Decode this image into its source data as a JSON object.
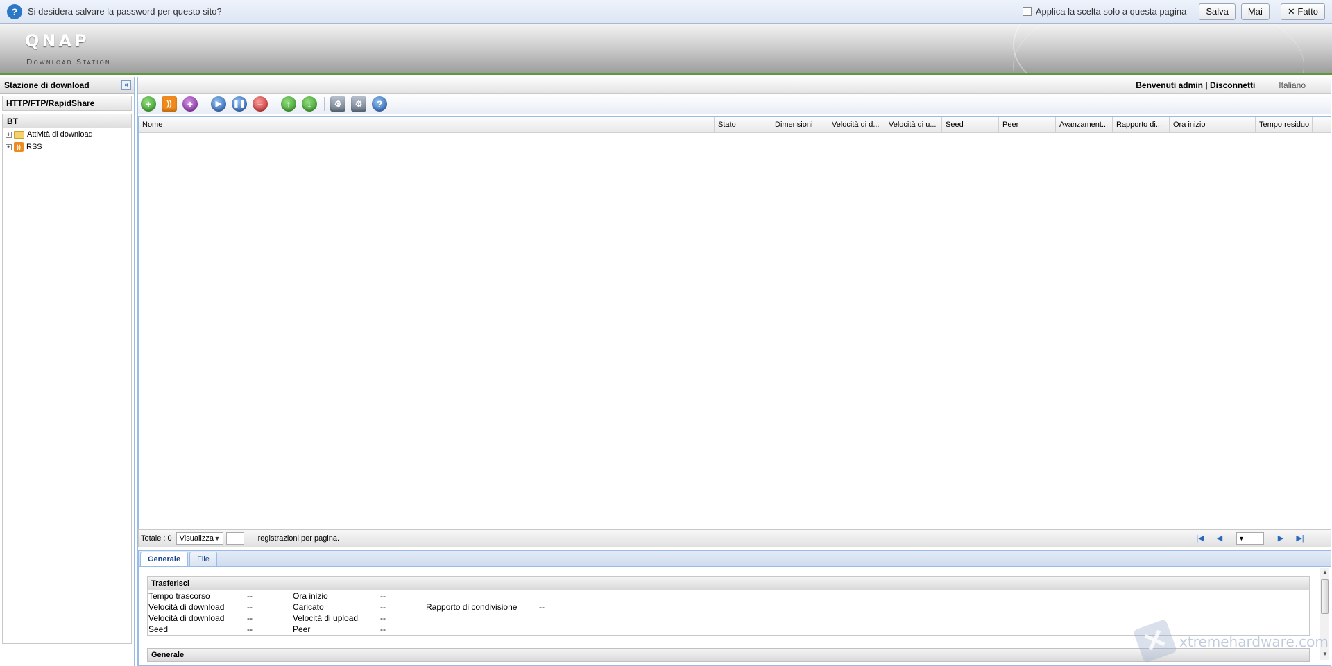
{
  "password_bar": {
    "message": "Si desidera salvare la password per questo sito?",
    "apply_label": "Applica la scelta solo a questa pagina",
    "save": "Salva",
    "never": "Mai",
    "done": "Fatto"
  },
  "header": {
    "logo": "QNAP",
    "subtitle": "Download Station"
  },
  "sidebar": {
    "title": "Stazione di download",
    "sections": [
      "HTTP/FTP/RapidShare"
    ],
    "bt_header": "BT",
    "tree": [
      {
        "label": "Attività di download",
        "icon": "folder-icon"
      },
      {
        "label": "RSS",
        "icon": "rss-icon"
      }
    ]
  },
  "topbar": {
    "welcome": "Benvenuti admin | Disconnetti",
    "language": "Italiano"
  },
  "toolbar": {
    "icons": [
      "add-icon",
      "add-rss-icon",
      "add-alt-icon",
      "start-icon",
      "pause-icon",
      "stop-icon",
      "move-up-icon",
      "move-down-icon",
      "settings-icon",
      "config-icon",
      "help-icon"
    ]
  },
  "grid": {
    "columns": [
      "Nome",
      "Stato",
      "Dimensioni",
      "Velocità di d...",
      "Velocità di u...",
      "Seed",
      "Peer",
      "Avanzament...",
      "Rapporto di...",
      "Ora inizio",
      "Tempo residuo"
    ],
    "rows": []
  },
  "pager": {
    "total": "Totale : 0",
    "view_label": "Visualizza",
    "per_page": "registrazioni per pagina."
  },
  "tabs": [
    "Generale",
    "File"
  ],
  "details": {
    "section1": "Trasferisci",
    "rows": [
      [
        "Tempo trascorso",
        "--",
        "Ora inizio",
        "--",
        "",
        ""
      ],
      [
        "Velocità di download",
        "--",
        "Caricato",
        "--",
        "Rapporto di condivisione",
        "--"
      ],
      [
        "Velocità di download",
        "--",
        "Velocità di upload",
        "--",
        "",
        ""
      ],
      [
        "Seed",
        "--",
        "Peer",
        "--",
        "",
        ""
      ]
    ],
    "section2": "Generale"
  },
  "watermark": "xtremehardware.com"
}
